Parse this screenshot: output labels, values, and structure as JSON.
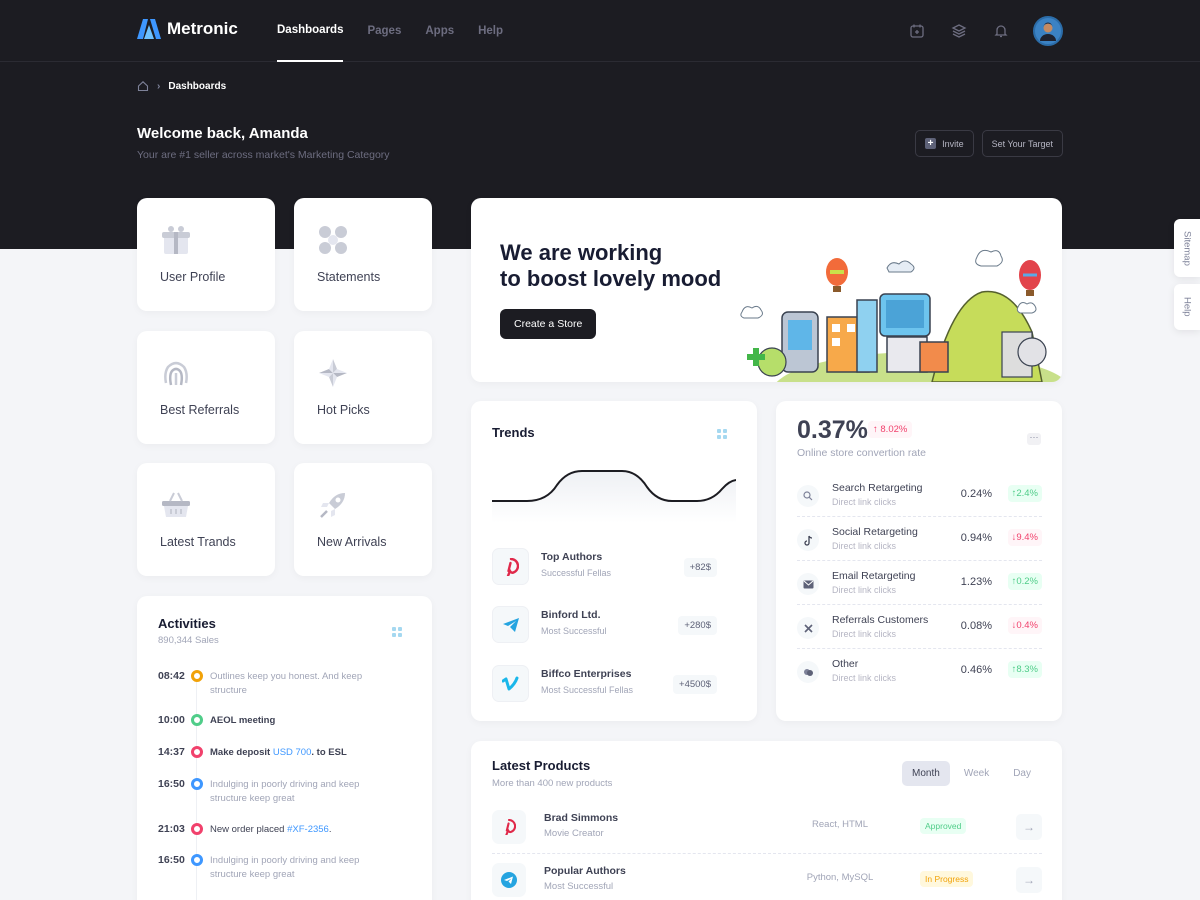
{
  "brand": {
    "name": "Metronic"
  },
  "nav": {
    "items": [
      "Dashboards",
      "Pages",
      "Apps",
      "Help"
    ],
    "active": "Dashboards"
  },
  "topbar_icons": [
    "calendar-add-icon",
    "layers-icon",
    "notification-bell-icon",
    "user-avatar"
  ],
  "breadcrumb": {
    "current": "Dashboards"
  },
  "header": {
    "welcome": "Welcome back, Amanda",
    "subtitle": "Your are #1 seller across market's Marketing Category",
    "invite_label": "Invite",
    "target_label": "Set Your Target"
  },
  "tiles": [
    {
      "label": "User Profile",
      "icon": "gift-icon"
    },
    {
      "label": "Statements",
      "icon": "abstract-icon"
    },
    {
      "label": "Best Referrals",
      "icon": "fingerprint-icon"
    },
    {
      "label": "Hot Picks",
      "icon": "star-burst-icon"
    },
    {
      "label": "Latest Trands",
      "icon": "basket-icon"
    },
    {
      "label": "New Arrivals",
      "icon": "rocket-icon"
    }
  ],
  "banner": {
    "line1": "We are working",
    "line2": "to boost lovely mood",
    "cta": "Create a Store"
  },
  "trends": {
    "title": "Trends",
    "items": [
      {
        "name": "Top Authors",
        "sub": "Successful Fellas",
        "value": "+82$",
        "icon": "pinterest-icon"
      },
      {
        "name": "Binford Ltd.",
        "sub": "Most Successful",
        "value": "+280$",
        "icon": "telegram-icon"
      },
      {
        "name": "Biffco Enterprises",
        "sub": "Most Successful Fellas",
        "value": "+4500$",
        "icon": "vimeo-icon"
      }
    ]
  },
  "conversion": {
    "rate": "0.37%",
    "change": "8.02%",
    "label": "Online store convertion rate",
    "items": [
      {
        "name": "Search Retargeting",
        "sub": "Direct link clicks",
        "value": "0.24%",
        "change": "2.4%",
        "dir": "up",
        "icon": "search-icon"
      },
      {
        "name": "Social Retargeting",
        "sub": "Direct link clicks",
        "value": "0.94%",
        "change": "9.4%",
        "dir": "down",
        "icon": "tiktok-icon"
      },
      {
        "name": "Email Retargeting",
        "sub": "Direct link clicks",
        "value": "1.23%",
        "change": "0.2%",
        "dir": "up",
        "icon": "sms-icon"
      },
      {
        "name": "Referrals Customers",
        "sub": "Direct link clicks",
        "value": "0.08%",
        "change": "0.4%",
        "dir": "down",
        "icon": "icon-referral"
      },
      {
        "name": "Other",
        "sub": "Direct link clicks",
        "value": "0.46%",
        "change": "8.3%",
        "dir": "up",
        "icon": "abstract-25-icon"
      }
    ]
  },
  "activities": {
    "title": "Activities",
    "subtitle": "890,344 Sales",
    "items": [
      {
        "time": "08:42",
        "text": "Outlines keep you honest. And keep structure",
        "color": "#f1a208",
        "style": "muted"
      },
      {
        "time": "10:00",
        "text": "AEOL meeting",
        "color": "#50cd89",
        "style": "bold"
      },
      {
        "time": "14:37",
        "text": "Make deposit ",
        "link": "USD 700",
        "after": ". to ESL",
        "color": "#f1416c",
        "style": "bold"
      },
      {
        "time": "16:50",
        "text": "Indulging in poorly driving and keep structure keep great",
        "color": "#3e97ff",
        "style": "muted"
      },
      {
        "time": "21:03",
        "text": "New order placed ",
        "link": "#XF-2356",
        "after": ".",
        "color": "#f1416c",
        "style": "bold"
      },
      {
        "time": "16:50",
        "text": "Indulging in poorly driving and keep structure keep great",
        "color": "#3e97ff",
        "style": "muted"
      }
    ]
  },
  "products": {
    "title": "Latest Products",
    "subtitle": "More than 400 new products",
    "tabs": [
      "Month",
      "Week",
      "Day"
    ],
    "active_tab": "Month",
    "rows": [
      {
        "name": "Brad Simmons",
        "sub": "Movie Creator",
        "tech": "React, HTML",
        "status": "Approved",
        "status_type": "approved",
        "icon": "pinterest-icon"
      },
      {
        "name": "Popular Authors",
        "sub": "Most Successful",
        "tech": "Python, MySQL",
        "status": "In Progress",
        "status_type": "progress",
        "icon": "telegram-icon"
      }
    ]
  },
  "side_tabs": [
    "Sitemap",
    "Help"
  ],
  "colors": {
    "dark": "#1c1c22",
    "success": "#50cd89",
    "danger": "#f1416c",
    "primary": "#3e97ff",
    "warning": "#f1a208"
  }
}
